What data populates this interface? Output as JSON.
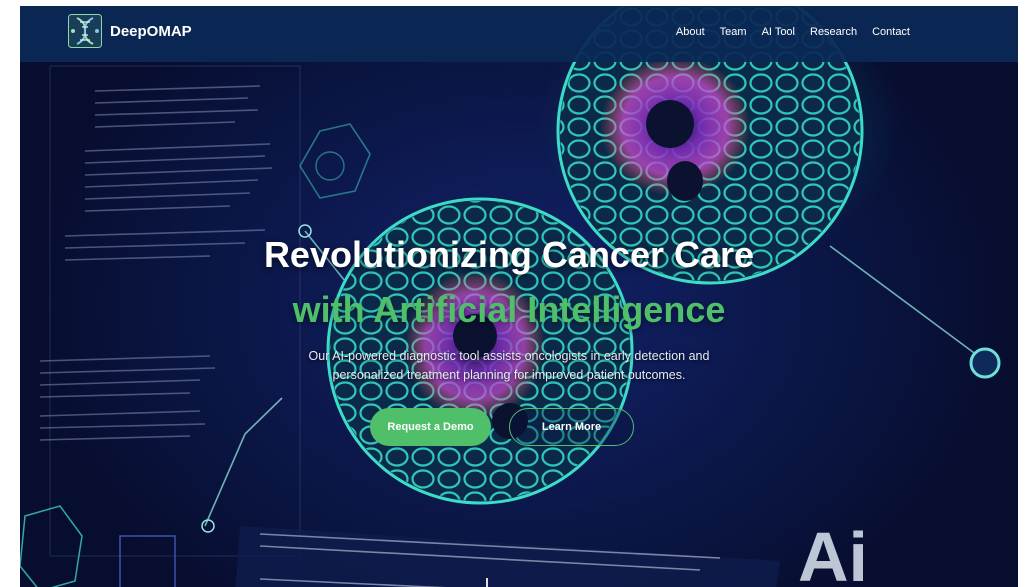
{
  "brand": {
    "name": "DeepOMAP",
    "logo_icon": "dna-logo-icon"
  },
  "nav": {
    "items": [
      {
        "label": "About"
      },
      {
        "label": "Team"
      },
      {
        "label": "AI Tool"
      },
      {
        "label": "Research"
      },
      {
        "label": "Contact"
      }
    ]
  },
  "hero": {
    "title_line1": "Revolutionizing Cancer Care",
    "title_line2": "with Artificial Intelligence",
    "subtitle_line1": "Our AI-powered diagnostic tool assists oncologists in early detection and",
    "subtitle_line2": "personalized treatment planning for improved patient outcomes.",
    "primary_button": "Request a Demo",
    "secondary_button": "Learn More",
    "background_text": "Ai"
  },
  "colors": {
    "accent": "#4fbf6a",
    "navbar": "#0b2855",
    "background": "#0a1440",
    "cell_teal": "#33d6c0",
    "cell_magenta": "#c04bd8"
  }
}
